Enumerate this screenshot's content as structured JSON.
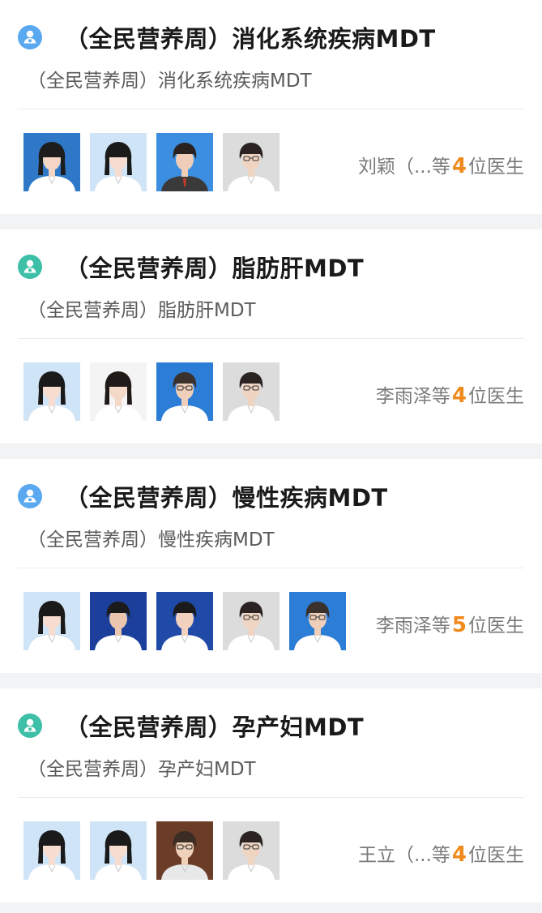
{
  "colors": {
    "icon_blue": "#5aa9f0",
    "icon_teal": "#3dbfa8",
    "count_orange": "#f08a1c",
    "background": "#f2f3f5"
  },
  "icons": {
    "team_icon": "user-badge-icon"
  },
  "cards": [
    {
      "title": "（全民营养周）消化系统疾病MDT",
      "subtitle": "（全民营养周）消化系统疾病MDT",
      "icon_color": "blue",
      "avatars": [
        "avatar-blue-bg",
        "avatar-light-bg",
        "avatar-blue-bg-short-hair",
        "avatar-gray-bg"
      ],
      "lead_doctor": "刘颖（...",
      "count_prefix": "等",
      "count": "4",
      "count_suffix": "位医生"
    },
    {
      "title": "（全民营养周）脂肪肝MDT",
      "subtitle": "（全民营养周）脂肪肝MDT",
      "icon_color": "teal",
      "avatars": [
        "avatar-light-bg",
        "avatar-white-bg",
        "avatar-blue-bg-glasses",
        "avatar-gray-bg"
      ],
      "lead_doctor": "李雨泽",
      "count_prefix": "等",
      "count": "4",
      "count_suffix": "位医生"
    },
    {
      "title": "（全民营养周）慢性疾病MDT",
      "subtitle": "（全民营养周）慢性疾病MDT",
      "icon_color": "blue",
      "avatars": [
        "avatar-light-bg",
        "avatar-navy-bg-male",
        "avatar-navy-bg",
        "avatar-gray-bg",
        "avatar-blue-bg-glasses"
      ],
      "lead_doctor": "李雨泽",
      "count_prefix": "等",
      "count": "5",
      "count_suffix": "位医生"
    },
    {
      "title": "（全民营养周）孕产妇MDT",
      "subtitle": "（全民营养周）孕产妇MDT",
      "icon_color": "teal",
      "avatars": [
        "avatar-light-bg",
        "avatar-light-bg",
        "avatar-brown-bg-elder",
        "avatar-gray-bg"
      ],
      "lead_doctor": "王立（...",
      "count_prefix": "等",
      "count": "4",
      "count_suffix": "位医生"
    }
  ]
}
